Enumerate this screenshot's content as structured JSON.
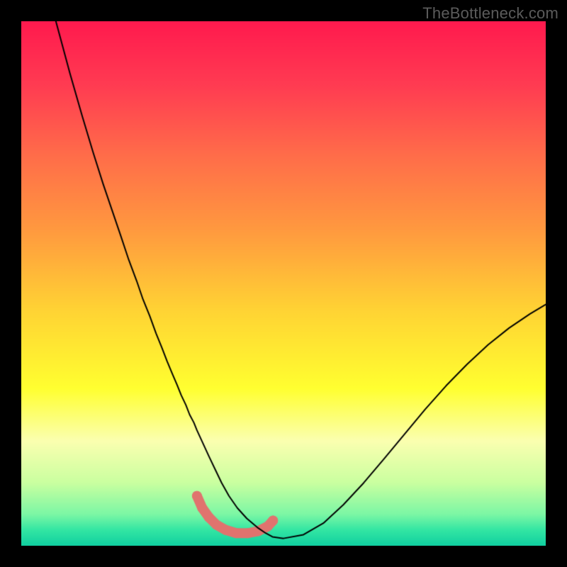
{
  "watermark": "TheBottleneck.com",
  "chart_data": {
    "type": "line",
    "title": "",
    "xlabel": "",
    "ylabel": "",
    "xlim": [
      0,
      1
    ],
    "ylim": [
      0,
      1
    ],
    "background_gradient": {
      "stops": [
        {
          "t": 0.0,
          "color": "#ff1a4e"
        },
        {
          "t": 0.12,
          "color": "#ff3b52"
        },
        {
          "t": 0.25,
          "color": "#ff6b4a"
        },
        {
          "t": 0.4,
          "color": "#ff9a3f"
        },
        {
          "t": 0.55,
          "color": "#ffd334"
        },
        {
          "t": 0.7,
          "color": "#ffff30"
        },
        {
          "t": 0.8,
          "color": "#fbffb0"
        },
        {
          "t": 0.88,
          "color": "#caffa0"
        },
        {
          "t": 0.94,
          "color": "#7cf7a5"
        },
        {
          "t": 0.97,
          "color": "#33e6a3"
        },
        {
          "t": 1.0,
          "color": "#10cfa0"
        }
      ]
    },
    "series": [
      {
        "name": "bottleneck-curve",
        "stroke": "#000000",
        "stroke_width": 2,
        "x": [
          0.066,
          0.093,
          0.116,
          0.137,
          0.156,
          0.173,
          0.19,
          0.205,
          0.22,
          0.232,
          0.245,
          0.257,
          0.268,
          0.278,
          0.288,
          0.297,
          0.305,
          0.314,
          0.321,
          0.329,
          0.335,
          0.358,
          0.37,
          0.382,
          0.396,
          0.412,
          0.43,
          0.45,
          0.466,
          0.479,
          0.5,
          0.538,
          0.576,
          0.614,
          0.653,
          0.692,
          0.731,
          0.77,
          0.81,
          0.85,
          0.89,
          0.93,
          0.97,
          1.0
        ],
        "y": [
          1.0,
          0.9,
          0.82,
          0.75,
          0.69,
          0.64,
          0.59,
          0.545,
          0.505,
          0.47,
          0.438,
          0.405,
          0.378,
          0.352,
          0.328,
          0.307,
          0.287,
          0.268,
          0.25,
          0.235,
          0.22,
          0.17,
          0.145,
          0.12,
          0.095,
          0.072,
          0.052,
          0.035,
          0.024,
          0.017,
          0.014,
          0.021,
          0.043,
          0.078,
          0.12,
          0.166,
          0.213,
          0.26,
          0.305,
          0.346,
          0.383,
          0.415,
          0.442,
          0.46
        ]
      },
      {
        "name": "highlight-dots",
        "stroke": "#e0736e",
        "stroke_width": 14,
        "marker": "circle",
        "x": [
          0.335,
          0.345,
          0.358,
          0.372,
          0.39,
          0.41,
          0.432,
          0.452,
          0.47,
          0.48
        ],
        "y": [
          0.095,
          0.072,
          0.054,
          0.04,
          0.03,
          0.024,
          0.024,
          0.028,
          0.037,
          0.048
        ]
      }
    ]
  }
}
